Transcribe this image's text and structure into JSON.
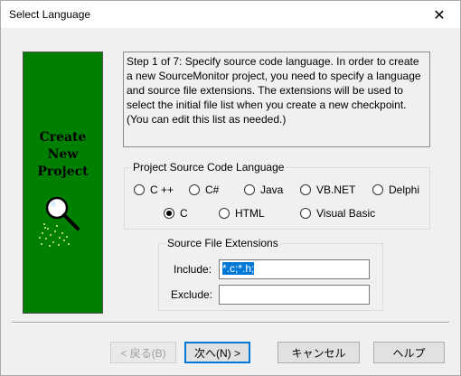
{
  "window": {
    "title": "Select Language",
    "close_glyph": "✕"
  },
  "banner": {
    "line1": "Create",
    "line2": "New",
    "line3": "Project",
    "icon": "magnifier-icon"
  },
  "step_text": "Step 1 of 7: Specify source code language. In order to create a new SourceMonitor project, you need to specify a language and source file extensions. The extensions will be used to select the initial file list when you create a new checkpoint. (You can edit this list as needed.)",
  "language_group": {
    "legend": "Project Source Code Language",
    "options": [
      "C ++",
      "C#",
      "Java",
      "VB.NET",
      "Delphi",
      "C",
      "HTML",
      "Visual Basic"
    ],
    "selected": "C"
  },
  "extensions_group": {
    "legend": "Source File Extensions",
    "include_label": "Include:",
    "include_value": "*.c;*.h;",
    "exclude_label": "Exclude:",
    "exclude_value": ""
  },
  "buttons": {
    "back": "< 戻る(B)",
    "next": "次へ(N) >",
    "cancel": "キャンセル",
    "help": "ヘルプ"
  },
  "colors": {
    "banner": "#008000",
    "selection": "#0078d7"
  }
}
